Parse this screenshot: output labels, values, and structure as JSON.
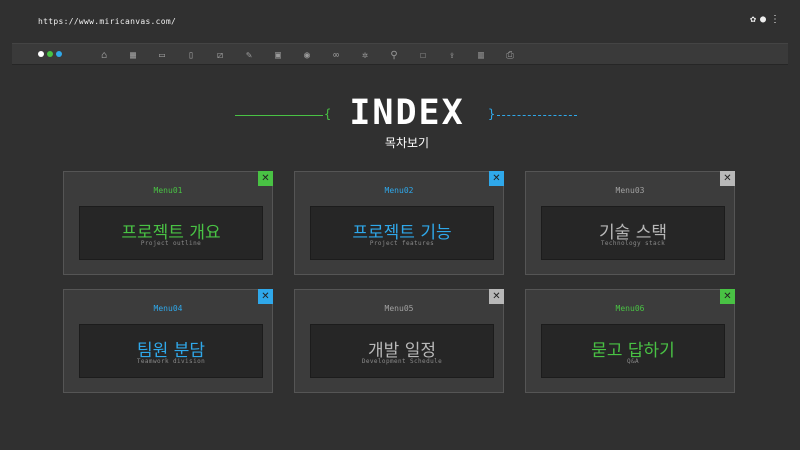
{
  "browser": {
    "url": "https://www.miricanvas.com/",
    "icons": [
      "settings-icon",
      "info-icon",
      "more-icon"
    ]
  },
  "toolbar": {
    "dots": [
      "#ffffff",
      "#49c244",
      "#2fa8ea"
    ],
    "icons": [
      "home-icon",
      "grid-icon",
      "folder-icon",
      "file-icon",
      "crop-icon",
      "pen-icon",
      "save-icon",
      "eye-icon",
      "link-icon",
      "gear-icon",
      "search-icon",
      "edit-icon",
      "upload-icon",
      "chart-icon",
      "print-icon"
    ]
  },
  "hero": {
    "title": "INDEX",
    "subtitle": "목차보기",
    "open_brace": "{",
    "close_brace": "}"
  },
  "cards": [
    {
      "menu": "Menu01",
      "title": "프로젝트 개요",
      "subtitle": "Project outline",
      "accent": "#49c244",
      "label_color": "#49c244",
      "close_color": "#49c244"
    },
    {
      "menu": "Menu02",
      "title": "프로젝트 기능",
      "subtitle": "Project features",
      "accent": "#2fa8ea",
      "label_color": "#2fa8ea",
      "close_color": "#2fa8ea"
    },
    {
      "menu": "Menu03",
      "title": "기술 스택",
      "subtitle": "Technology stack",
      "accent": "#b8b8b8",
      "label_color": "#a0a0a0",
      "close_color": "#b8b8b8"
    },
    {
      "menu": "Menu04",
      "title": "팀원 분담",
      "subtitle": "Teamwork division",
      "accent": "#2fa8ea",
      "label_color": "#2fa8ea",
      "close_color": "#2fa8ea"
    },
    {
      "menu": "Menu05",
      "title": "개발 일정",
      "subtitle": "Development Schedule",
      "accent": "#b8b8b8",
      "label_color": "#a0a0a0",
      "close_color": "#b8b8b8"
    },
    {
      "menu": "Menu06",
      "title": "묻고 답하기",
      "subtitle": "Q&A",
      "accent": "#49c244",
      "label_color": "#49c244",
      "close_color": "#49c244"
    }
  ],
  "close_symbol": "✕"
}
